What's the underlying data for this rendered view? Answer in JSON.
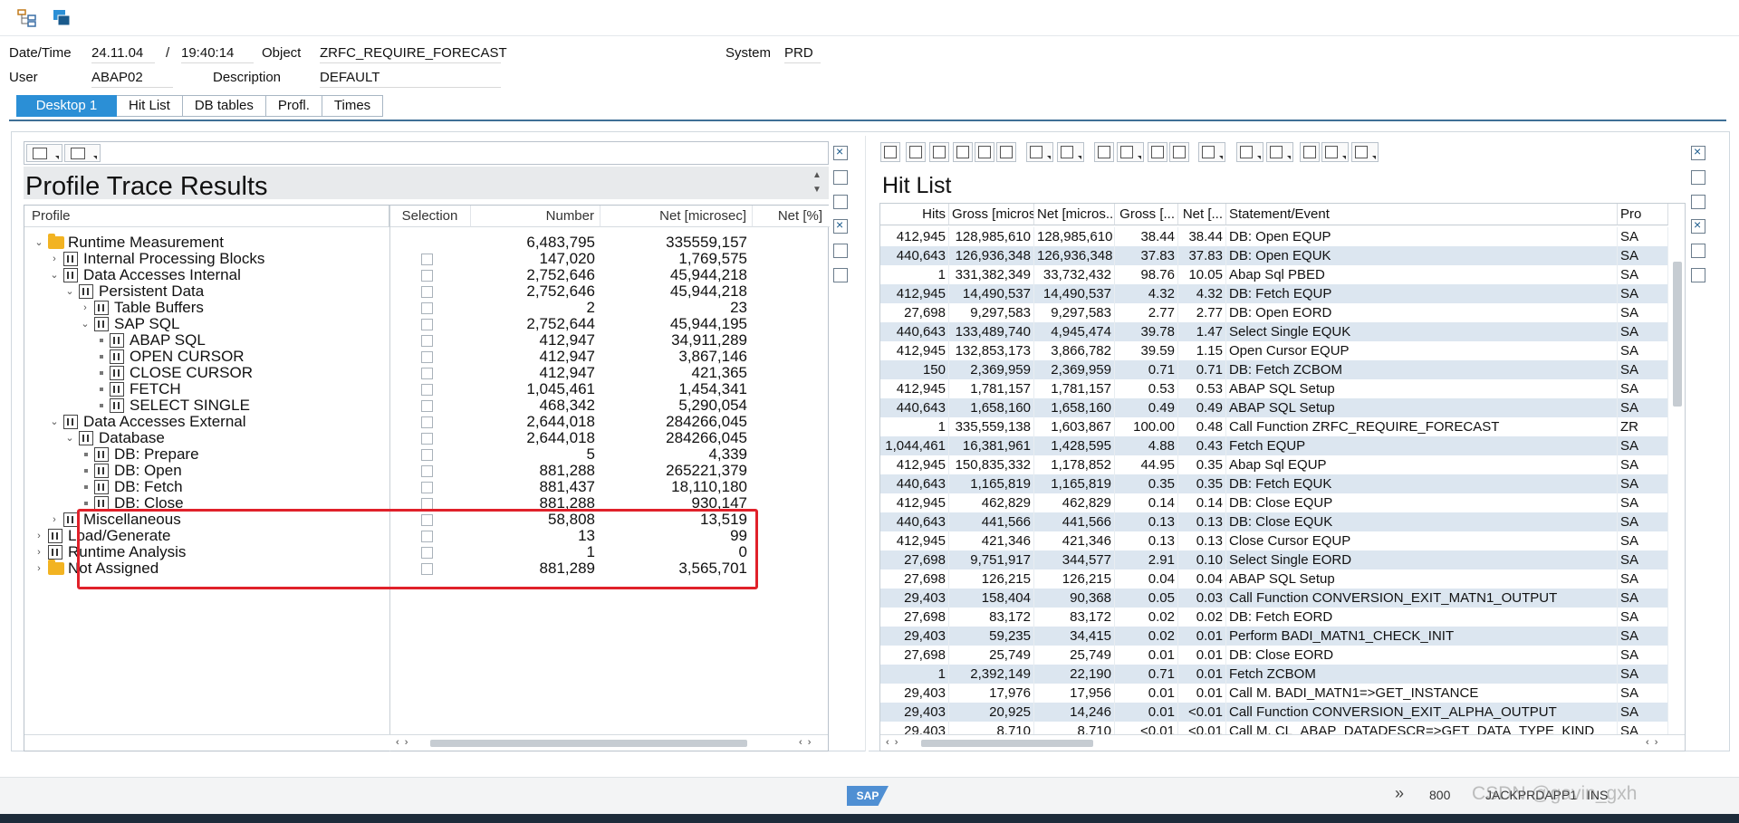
{
  "header": {
    "datetime_label": "Date/Time",
    "date": "24.11.04",
    "slash": "/",
    "time": "19:40:14",
    "object_label": "Object",
    "object_value": "ZRFC_REQUIRE_FORECAST",
    "system_label": "System",
    "system_value": "PRD",
    "user_label": "User",
    "user_value": "ABAP02",
    "description_label": "Description",
    "description_value": "DEFAULT"
  },
  "tabs": [
    "Desktop 1",
    "Hit List",
    "DB tables",
    "Profl.",
    "Times"
  ],
  "left_panel": {
    "title": "Profile Trace Results",
    "columns": {
      "profile": "Profile",
      "selection": "Selection",
      "number": "Number",
      "net": "Net [microsec]",
      "net_pct": "Net [%]"
    },
    "rows": [
      {
        "label": "Runtime Measurement",
        "number": "6,483,795",
        "net": "335559,157"
      },
      {
        "label": "Internal Processing Blocks",
        "number": "147,020",
        "net": "1,769,575"
      },
      {
        "label": "Data Accesses Internal",
        "number": "2,752,646",
        "net": "45,944,218"
      },
      {
        "label": "Persistent Data",
        "number": "2,752,646",
        "net": "45,944,218"
      },
      {
        "label": "Table Buffers",
        "number": "2",
        "net": "23"
      },
      {
        "label": "SAP SQL",
        "number": "2,752,644",
        "net": "45,944,195"
      },
      {
        "label": "ABAP SQL",
        "number": "412,947",
        "net": "34,911,289"
      },
      {
        "label": "OPEN CURSOR",
        "number": "412,947",
        "net": "3,867,146"
      },
      {
        "label": "CLOSE CURSOR",
        "number": "412,947",
        "net": "421,365"
      },
      {
        "label": "FETCH",
        "number": "1,045,461",
        "net": "1,454,341"
      },
      {
        "label": "SELECT SINGLE",
        "number": "468,342",
        "net": "5,290,054"
      },
      {
        "label": "Data Accesses External",
        "number": "2,644,018",
        "net": "284266,045"
      },
      {
        "label": "Database",
        "number": "2,644,018",
        "net": "284266,045"
      },
      {
        "label": "DB: Prepare",
        "number": "5",
        "net": "4,339"
      },
      {
        "label": "DB: Open",
        "number": "881,288",
        "net": "265221,379"
      },
      {
        "label": "DB: Fetch",
        "number": "881,437",
        "net": "18,110,180"
      },
      {
        "label": "DB: Close",
        "number": "881,288",
        "net": "930,147"
      },
      {
        "label": "Miscellaneous",
        "number": "58,808",
        "net": "13,519"
      },
      {
        "label": "Load/Generate",
        "number": "13",
        "net": "99"
      },
      {
        "label": "Runtime Analysis",
        "number": "1",
        "net": "0"
      },
      {
        "label": "Not Assigned",
        "number": "881,289",
        "net": "3,565,701"
      }
    ]
  },
  "hit_list": {
    "title": "Hit List",
    "columns": [
      "Hits",
      "Gross [micros...",
      "Net [micros...",
      "Gross [...",
      "Net [...",
      "Statement/Event",
      "Pro"
    ],
    "rows": [
      [
        "412,945",
        "128,985,610",
        "128,985,610",
        "38.44",
        "38.44",
        "DB: Open EQUP",
        "SA"
      ],
      [
        "440,643",
        "126,936,348",
        "126,936,348",
        "37.83",
        "37.83",
        "DB: Open EQUK",
        "SA"
      ],
      [
        "1",
        "331,382,349",
        "33,732,432",
        "98.76",
        "10.05",
        "Abap Sql PBED",
        "SA"
      ],
      [
        "412,945",
        "14,490,537",
        "14,490,537",
        "4.32",
        "4.32",
        "DB: Fetch EQUP",
        "SA"
      ],
      [
        "27,698",
        "9,297,583",
        "9,297,583",
        "2.77",
        "2.77",
        "DB: Open EORD",
        "SA"
      ],
      [
        "440,643",
        "133,489,740",
        "4,945,474",
        "39.78",
        "1.47",
        "Select Single EQUK",
        "SA"
      ],
      [
        "412,945",
        "132,853,173",
        "3,866,782",
        "39.59",
        "1.15",
        "Open Cursor EQUP",
        "SA"
      ],
      [
        "150",
        "2,369,959",
        "2,369,959",
        "0.71",
        "0.71",
        "DB: Fetch ZCBOM",
        "SA"
      ],
      [
        "412,945",
        "1,781,157",
        "1,781,157",
        "0.53",
        "0.53",
        "ABAP SQL Setup",
        "SA"
      ],
      [
        "440,643",
        "1,658,160",
        "1,658,160",
        "0.49",
        "0.49",
        "ABAP SQL Setup",
        "SA"
      ],
      [
        "1",
        "335,559,138",
        "1,603,867",
        "100.00",
        "0.48",
        "Call Function ZRFC_REQUIRE_FORECAST",
        "ZR"
      ],
      [
        "1,044,461",
        "16,381,961",
        "1,428,595",
        "4.88",
        "0.43",
        "Fetch EQUP",
        "SA"
      ],
      [
        "412,945",
        "150,835,332",
        "1,178,852",
        "44.95",
        "0.35",
        "Abap Sql EQUP",
        "SA"
      ],
      [
        "440,643",
        "1,165,819",
        "1,165,819",
        "0.35",
        "0.35",
        "DB: Fetch EQUK",
        "SA"
      ],
      [
        "412,945",
        "462,829",
        "462,829",
        "0.14",
        "0.14",
        "DB: Close EQUP",
        "SA"
      ],
      [
        "440,643",
        "441,566",
        "441,566",
        "0.13",
        "0.13",
        "DB: Close EQUK",
        "SA"
      ],
      [
        "412,945",
        "421,346",
        "421,346",
        "0.13",
        "0.13",
        "Close Cursor EQUP",
        "SA"
      ],
      [
        "27,698",
        "9,751,917",
        "344,577",
        "2.91",
        "0.10",
        "Select Single EORD",
        "SA"
      ],
      [
        "27,698",
        "126,215",
        "126,215",
        "0.04",
        "0.04",
        "ABAP SQL Setup",
        "SA"
      ],
      [
        "29,403",
        "158,404",
        "90,368",
        "0.05",
        "0.03",
        "Call Function CONVERSION_EXIT_MATN1_OUTPUT",
        "SA"
      ],
      [
        "27,698",
        "83,172",
        "83,172",
        "0.02",
        "0.02",
        "DB: Fetch EORD",
        "SA"
      ],
      [
        "29,403",
        "59,235",
        "34,415",
        "0.02",
        "0.01",
        "Perform BADI_MATN1_CHECK_INIT",
        "SA"
      ],
      [
        "27,698",
        "25,749",
        "25,749",
        "0.01",
        "0.01",
        "DB: Close EORD",
        "SA"
      ],
      [
        "1",
        "2,392,149",
        "22,190",
        "0.71",
        "0.01",
        "Fetch ZCBOM",
        "SA"
      ],
      [
        "29,403",
        "17,976",
        "17,956",
        "0.01",
        "0.01",
        "Call M. BADI_MATN1=>GET_INSTANCE",
        "SA"
      ],
      [
        "29,403",
        "20,925",
        "14,246",
        "0.01",
        "<0.01",
        "Call Function CONVERSION_EXIT_ALPHA_OUTPUT",
        "SA"
      ],
      [
        "29,403",
        "8,710",
        "8,710",
        "<0.01",
        "<0.01",
        "Call M. CL_ABAP_DATADESCR=>GET_DATA_TYPE_KIND",
        "SA"
      ]
    ]
  },
  "status_bar": {
    "client": "800",
    "server": "JACKPRDAPP1",
    "ins": "INS",
    "logo": "SAP",
    "watermark": "CSDN @gavin_gxh"
  },
  "colors": {
    "tab_active": "#2b8fd6",
    "row_alt": "#dce6f0",
    "highlight": "#e0212a"
  }
}
